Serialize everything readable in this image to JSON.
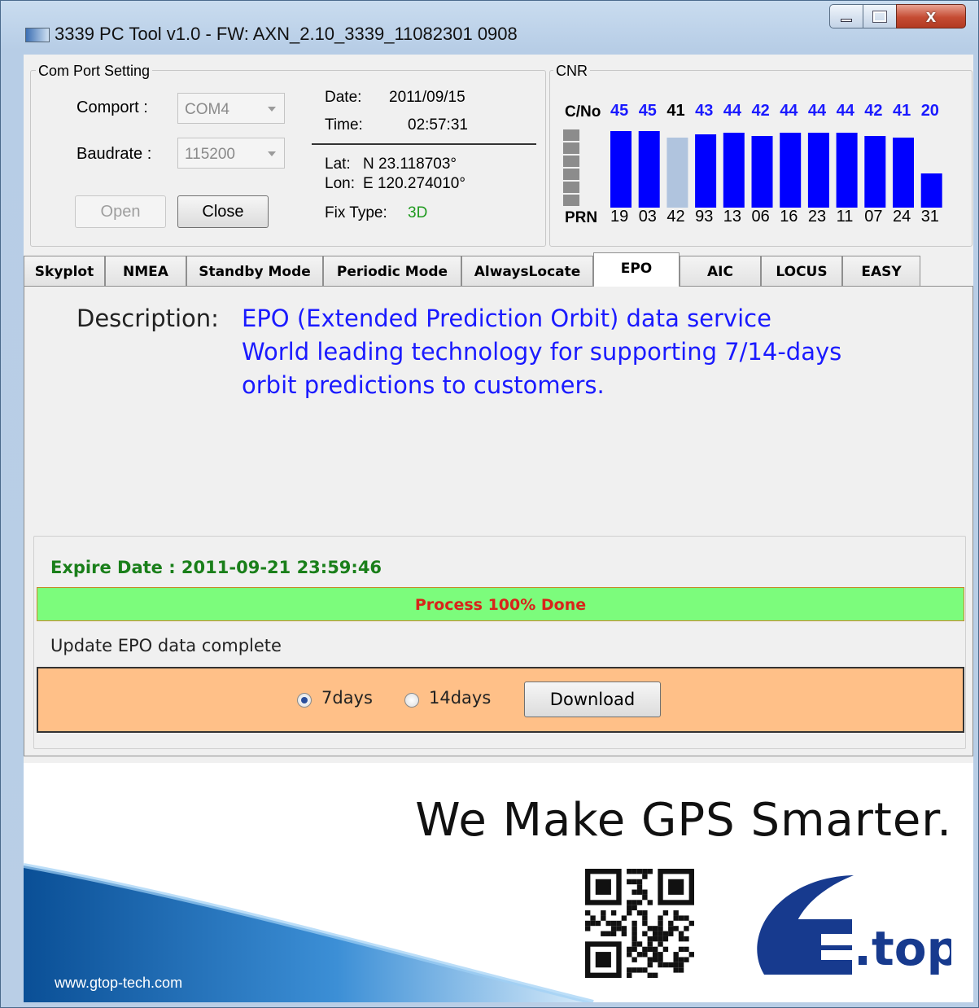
{
  "window": {
    "title": "3339 PC Tool v1.0 - FW: AXN_2.10_3339_11082301 0908",
    "close_glyph": "x"
  },
  "com_port": {
    "group_title": "Com Port Setting",
    "comport_label": "Comport :",
    "comport_value": "COM4",
    "baudrate_label": "Baudrate :",
    "baudrate_value": "115200",
    "open_label": "Open",
    "close_label": "Close",
    "date_label": "Date:",
    "date_value": "2011/09/15",
    "time_label": "Time:",
    "time_value": "02:57:31",
    "lat_label": "Lat:",
    "lat_value": "N 23.118703°",
    "lon_label": "Lon:",
    "lon_value": "E 120.274010°",
    "fix_label": "Fix Type:",
    "fix_value": "3D"
  },
  "cnr": {
    "group_title": "CNR",
    "cno_label": "C/No",
    "prn_label": "PRN",
    "satellites": [
      {
        "cno": "45",
        "prn": "19",
        "level": 45,
        "in_use": true
      },
      {
        "cno": "45",
        "prn": "03",
        "level": 45,
        "in_use": true
      },
      {
        "cno": "41",
        "prn": "42",
        "level": 41,
        "in_use": false
      },
      {
        "cno": "43",
        "prn": "93",
        "level": 43,
        "in_use": true
      },
      {
        "cno": "44",
        "prn": "13",
        "level": 44,
        "in_use": true
      },
      {
        "cno": "42",
        "prn": "06",
        "level": 42,
        "in_use": true
      },
      {
        "cno": "44",
        "prn": "16",
        "level": 44,
        "in_use": true
      },
      {
        "cno": "44",
        "prn": "23",
        "level": 44,
        "in_use": true
      },
      {
        "cno": "44",
        "prn": "11",
        "level": 44,
        "in_use": true
      },
      {
        "cno": "42",
        "prn": "07",
        "level": 42,
        "in_use": true
      },
      {
        "cno": "41",
        "prn": "24",
        "level": 41,
        "in_use": true
      },
      {
        "cno": "20",
        "prn": "31",
        "level": 20,
        "in_use": true
      }
    ],
    "colors": {
      "in_use": "#0000ff",
      "not_used": "#b0c4de",
      "scale": "#8c8c8c"
    }
  },
  "tabs": [
    {
      "label": "Skyplot",
      "active": false
    },
    {
      "label": "NMEA",
      "active": false
    },
    {
      "label": "Standby Mode",
      "active": false
    },
    {
      "label": "Periodic Mode",
      "active": false
    },
    {
      "label": "AlwaysLocate",
      "active": false
    },
    {
      "label": "EPO",
      "active": true
    },
    {
      "label": "AIC",
      "active": false
    },
    {
      "label": "LOCUS",
      "active": false
    },
    {
      "label": "EASY",
      "active": false
    }
  ],
  "epo": {
    "description_label": "Description:",
    "description_lines": [
      "EPO (Extended Prediction Orbit) data service",
      "World leading technology for supporting 7/14-days",
      "orbit predictions to customers."
    ],
    "expire_date": "Expire Date : 2011-09-21 23:59:46",
    "progress_text": "Process 100% Done",
    "progress_fraction": 1.0,
    "status_text": "Update EPO data complete",
    "option_7days": "7days",
    "option_14days": "14days",
    "selected_option": "7days",
    "download_label": "Download"
  },
  "banner": {
    "slogan": "We Make GPS Smarter.",
    "website": "www.gtop-tech.com",
    "logo_text": ".top"
  }
}
